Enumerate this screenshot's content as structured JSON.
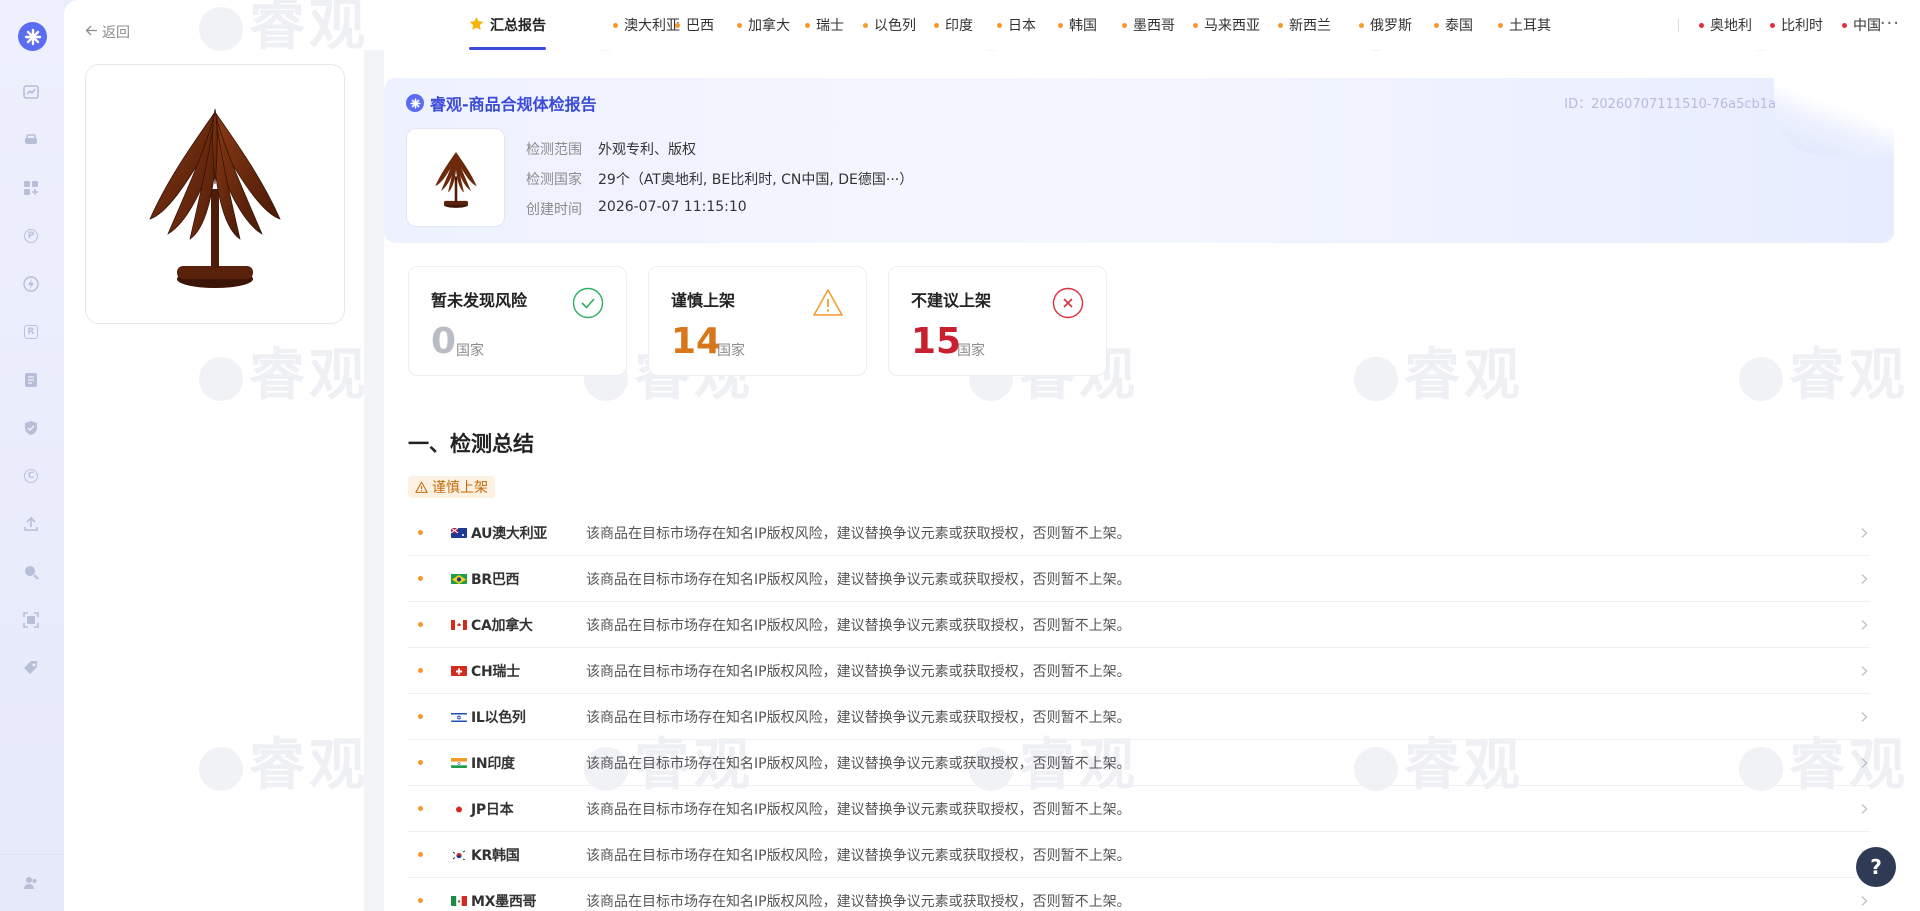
{
  "nav": {
    "back_label": "返回"
  },
  "tabs": [
    {
      "label": "汇总报告",
      "active": true,
      "color": "#f4b40a"
    },
    {
      "label": "澳大利亚",
      "color": "#f39a2b"
    },
    {
      "label": "巴西",
      "color": "#f39a2b"
    },
    {
      "label": "加拿大",
      "color": "#f39a2b"
    },
    {
      "label": "瑞士",
      "color": "#f39a2b"
    },
    {
      "label": "以色列",
      "color": "#f39a2b"
    },
    {
      "label": "印度",
      "color": "#f39a2b"
    },
    {
      "label": "日本",
      "color": "#f39a2b"
    },
    {
      "label": "韩国",
      "color": "#f39a2b"
    },
    {
      "label": "墨西哥",
      "color": "#f39a2b"
    },
    {
      "label": "马来西亚",
      "color": "#f39a2b"
    },
    {
      "label": "新西兰",
      "color": "#f39a2b"
    },
    {
      "label": "俄罗斯",
      "color": "#f39a2b"
    },
    {
      "label": "泰国",
      "color": "#f39a2b"
    },
    {
      "label": "土耳其",
      "color": "#f39a2b"
    },
    {
      "label": "奥地利",
      "color": "#e0303d"
    },
    {
      "label": "比利时",
      "color": "#e0303d"
    },
    {
      "label": "中国",
      "color": "#e0303d"
    }
  ],
  "tabs_more": "···",
  "report": {
    "title": "睿观-商品合规体检报告",
    "id_text": "ID：20260707111510-76a5cb1a",
    "scope_label": "检测范围",
    "scope_value": "外观专利、版权",
    "countries_label": "检测国家",
    "countries_value": "29个（AT奥地利, BE比利时, CN中国, DE德国···）",
    "created_label": "创建时间",
    "created_value": "2026-07-07 11:15:10"
  },
  "summary_cards": [
    {
      "title": "暂未发现风险",
      "count": "0",
      "unit": "国家",
      "color": "#b9bcc6",
      "icon": "check-circle-icon",
      "icon_color": "#2eae62"
    },
    {
      "title": "谨慎上架",
      "count": "14",
      "unit": "国家",
      "color": "#d8761a",
      "icon": "warning-triangle-icon",
      "icon_color": "#f39a2b"
    },
    {
      "title": "不建议上架",
      "count": "15",
      "unit": "国家",
      "color": "#c8202f",
      "icon": "x-circle-icon",
      "icon_color": "#e0303d"
    }
  ],
  "section_title": "一、检测总结",
  "caution_badge": "谨慎上架",
  "caution_rows": [
    {
      "name": "AU澳大利亚",
      "desc": "该商品在目标市场存在知名IP版权风险，建议替换争议元素或获取授权，否则暂不上架。"
    },
    {
      "name": "BR巴西",
      "desc": "该商品在目标市场存在知名IP版权风险，建议替换争议元素或获取授权，否则暂不上架。"
    },
    {
      "name": "CA加拿大",
      "desc": "该商品在目标市场存在知名IP版权风险，建议替换争议元素或获取授权，否则暂不上架。"
    },
    {
      "name": "CH瑞士",
      "desc": "该商品在目标市场存在知名IP版权风险，建议替换争议元素或获取授权，否则暂不上架。"
    },
    {
      "name": "IL以色列",
      "desc": "该商品在目标市场存在知名IP版权风险，建议替换争议元素或获取授权，否则暂不上架。"
    },
    {
      "name": "IN印度",
      "desc": "该商品在目标市场存在知名IP版权风险，建议替换争议元素或获取授权，否则暂不上架。"
    },
    {
      "name": "JP日本",
      "desc": "该商品在目标市场存在知名IP版权风险，建议替换争议元素或获取授权，否则暂不上架。"
    },
    {
      "name": "KR韩国",
      "desc": "该商品在目标市场存在知名IP版权风险，建议替换争议元素或获取授权，否则暂不上架。"
    },
    {
      "name": "MX墨西哥",
      "desc": "该商品在目标市场存在知名IP版权风险，建议替换争议元素或获取授权，否则暂不上架。"
    }
  ],
  "help_label": "?",
  "watermark_text": "睿观"
}
